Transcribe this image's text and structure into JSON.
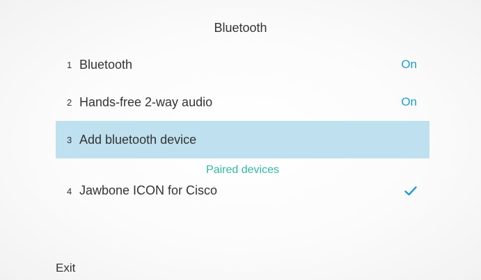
{
  "header": {
    "title": "Bluetooth"
  },
  "menu": {
    "items": [
      {
        "number": "1",
        "label": "Bluetooth",
        "value": "On"
      },
      {
        "number": "2",
        "label": "Hands-free 2-way audio",
        "value": "On"
      },
      {
        "number": "3",
        "label": "Add bluetooth device",
        "selected": true
      }
    ],
    "paired_section_title": "Paired devices",
    "paired_devices": [
      {
        "number": "4",
        "label": "Jawbone ICON for Cisco",
        "status_icon": "checkmark-icon",
        "connected": true
      }
    ]
  },
  "softkeys": {
    "exit_label": "Exit"
  },
  "colors": {
    "accent_blue": "#1e9ad6",
    "selection_bg": "#bfe0ee",
    "section_teal": "#2fb7a3",
    "text": "#333333"
  }
}
